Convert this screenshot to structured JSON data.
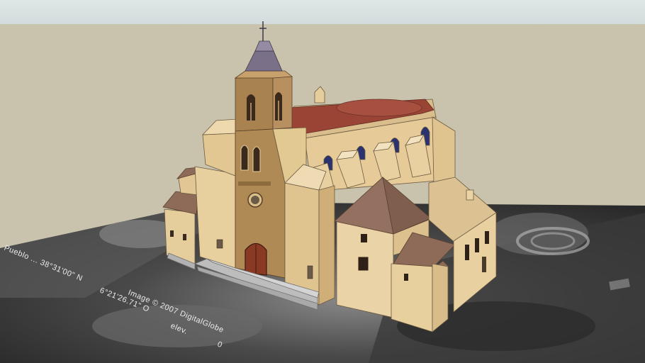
{
  "viewport": {
    "sky_color": "#d9e0e0",
    "ground_color": "#c8c1ab"
  },
  "model": {
    "subject": "church-3d-model",
    "wall_color": "#e8cfa0",
    "stone_color": "#b58a55",
    "roof_color": "#8a3a30",
    "tile_color": "#8b6a5a"
  },
  "terrain_imagery": {
    "coordinate_label": "Pueblo ... 38°31'00\" N",
    "copyright_label": "Image © 2007 DigitalGlobe",
    "longitude_label": "6°21'26.71\" O",
    "elevation_label": "elev.",
    "misc_label": "0"
  }
}
